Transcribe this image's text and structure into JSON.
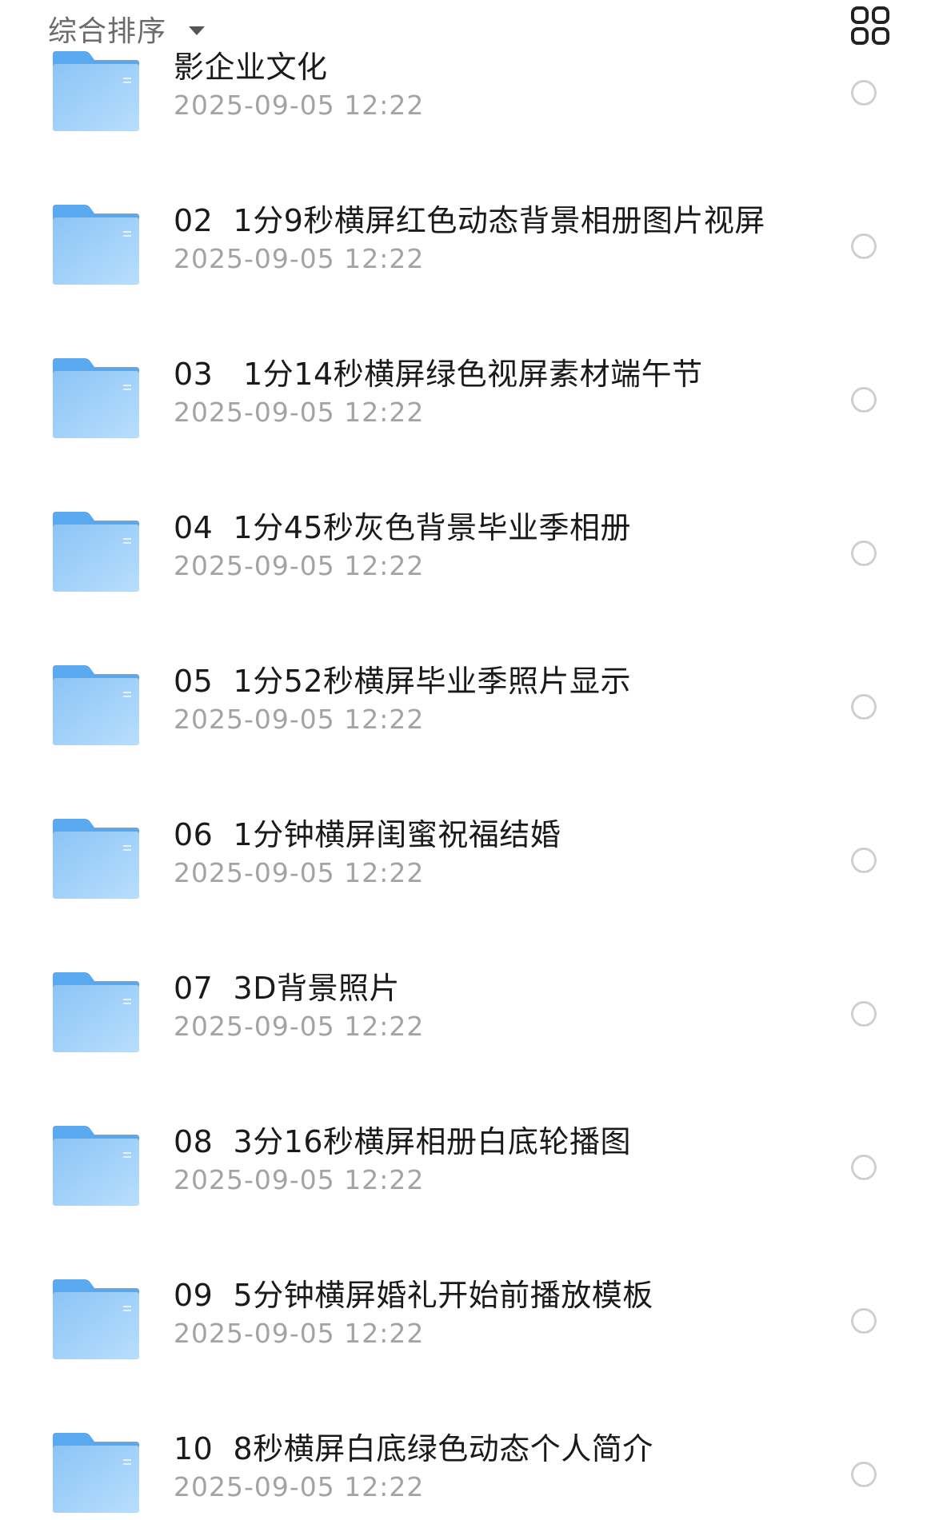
{
  "toolbar": {
    "sort_label": "综合排序",
    "sort_icon": "caret-down-icon",
    "view_icon": "grid-view-icon"
  },
  "colors": {
    "folder_light": "#9fcff9",
    "folder_dark": "#5aa9ef",
    "text_primary": "#1a1a1a",
    "text_secondary": "#a3a3a3",
    "radio_border": "#cfcfcf"
  },
  "files": [
    {
      "name": "影企业文化",
      "date": "2025-09-05 12:22",
      "icon": "folder-icon"
    },
    {
      "name": "02  1分9秒横屏红色动态背景相册图片视屏",
      "date": "2025-09-05 12:22",
      "icon": "folder-icon"
    },
    {
      "name": "03   1分14秒横屏绿色视屏素材端午节",
      "date": "2025-09-05 12:22",
      "icon": "folder-icon"
    },
    {
      "name": "04  1分45秒灰色背景毕业季相册",
      "date": "2025-09-05 12:22",
      "icon": "folder-icon"
    },
    {
      "name": "05  1分52秒横屏毕业季照片显示",
      "date": "2025-09-05 12:22",
      "icon": "folder-icon"
    },
    {
      "name": "06  1分钟横屏闺蜜祝福结婚",
      "date": "2025-09-05 12:22",
      "icon": "folder-icon"
    },
    {
      "name": "07  3D背景照片",
      "date": "2025-09-05 12:22",
      "icon": "folder-icon"
    },
    {
      "name": "08  3分16秒横屏相册白底轮播图",
      "date": "2025-09-05 12:22",
      "icon": "folder-icon"
    },
    {
      "name": "09  5分钟横屏婚礼开始前播放模板",
      "date": "2025-09-05 12:22",
      "icon": "folder-icon"
    },
    {
      "name": "10  8秒横屏白底绿色动态个人简介",
      "date": "2025-09-05 12:22",
      "icon": "folder-icon"
    }
  ]
}
